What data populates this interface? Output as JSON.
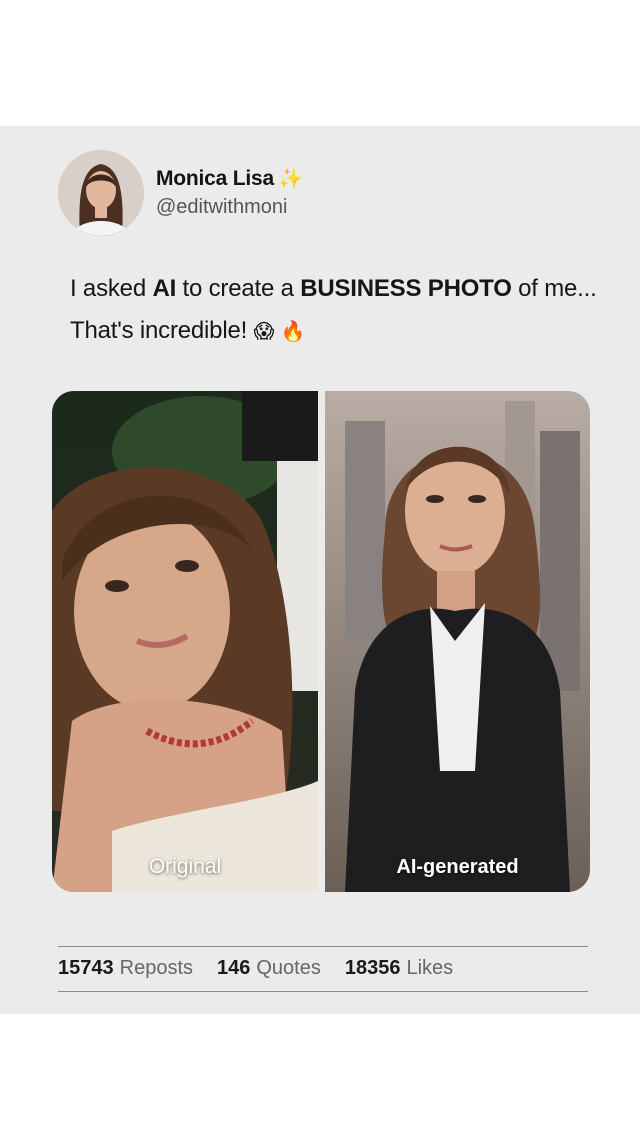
{
  "author": {
    "name": "Monica Lisa",
    "badge": "✨",
    "handle": "@editwithmoni",
    "avatar_icon": "profile-photo"
  },
  "post": {
    "part1": "I asked ",
    "bold1": "AI",
    "part2": " to create a ",
    "bold2": "BUSINESS PHOTO",
    "part3": " of me... That's incredible! ",
    "emoji1": "😱",
    "emoji2": "🔥"
  },
  "photos": [
    {
      "label": "Original",
      "icon": "selfie-photo"
    },
    {
      "label": "AI-generated",
      "icon": "business-portrait-photo"
    }
  ],
  "stats": {
    "reposts_count": "15743",
    "reposts_label": "Reposts",
    "quotes_count": "146",
    "quotes_label": "Quotes",
    "likes_count": "18356",
    "likes_label": "Likes"
  },
  "colors": {
    "card_bg": "#ebebeb",
    "text": "#161616",
    "muted": "#555555",
    "sparkle": "#f2cc4a"
  }
}
